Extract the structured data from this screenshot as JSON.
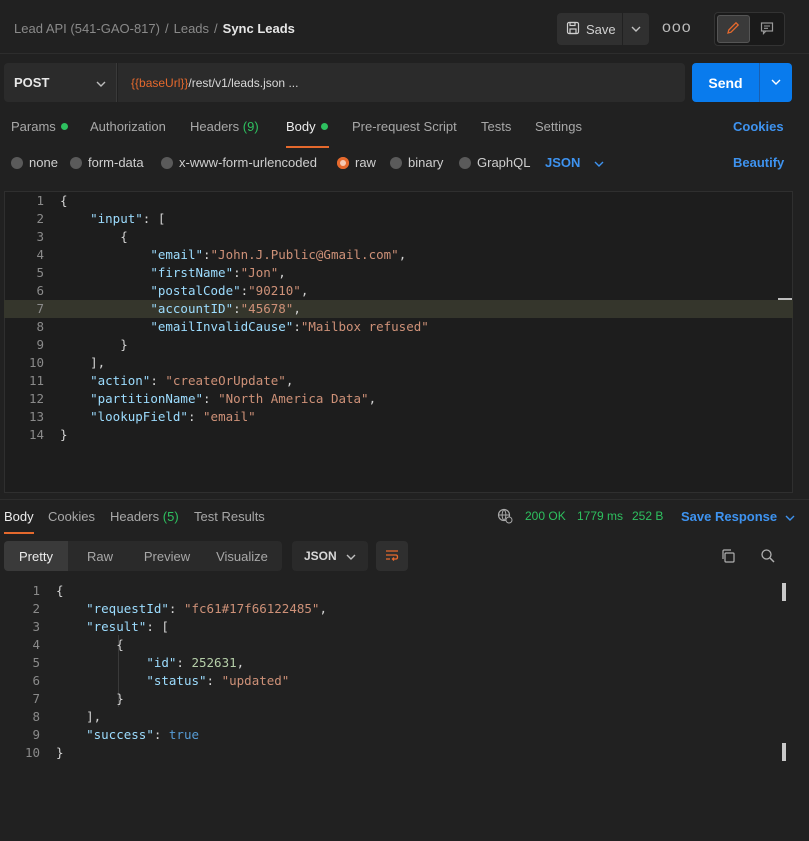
{
  "header": {
    "breadcrumb": [
      "Lead API (541-GAO-817)",
      "Leads",
      "Sync Leads"
    ],
    "separator": "/",
    "save_label": "Save",
    "more_label": "ooo"
  },
  "request": {
    "method": "POST",
    "url_variable": "{{baseUrl}}",
    "url_path": "/rest/v1/leads.json ...",
    "send_label": "Send",
    "tabs": [
      {
        "label": "Params",
        "dot": true
      },
      {
        "label": "Authorization"
      },
      {
        "label": "Headers",
        "count": "(9)"
      },
      {
        "label": "Body",
        "dot": true,
        "active": true
      },
      {
        "label": "Pre-request Script"
      },
      {
        "label": "Tests"
      },
      {
        "label": "Settings"
      }
    ],
    "cookies_label": "Cookies",
    "body_types": [
      "none",
      "form-data",
      "x-www-form-urlencoded",
      "raw",
      "binary",
      "GraphQL"
    ],
    "selected_body_type": "raw",
    "format_label": "JSON",
    "beautify_label": "Beautify",
    "body_lines": [
      "{",
      "    \"input\": [",
      "        {",
      "            \"email\":\"John.J.Public@Gmail.com\",",
      "            \"firstName\":\"Jon\",",
      "            \"postalCode\":\"90210\",",
      "            \"accountID\":\"45678\",",
      "            \"emailInvalidCause\":\"Mailbox refused\"",
      "        }",
      "    ],",
      "    \"action\": \"createOrUpdate\",",
      "    \"partitionName\": \"North America Data\",",
      "    \"lookupField\": \"email\"",
      "}"
    ],
    "highlighted_line": 7
  },
  "response": {
    "tabs": [
      {
        "label": "Body",
        "active": true
      },
      {
        "label": "Cookies"
      },
      {
        "label": "Headers",
        "count": "(5)"
      },
      {
        "label": "Test Results"
      }
    ],
    "status": "200 OK",
    "time": "1779 ms",
    "size": "252 B",
    "save_response_label": "Save Response",
    "view_modes": [
      "Pretty",
      "Raw",
      "Preview",
      "Visualize"
    ],
    "format_label": "JSON",
    "body_lines": [
      "{",
      "    \"requestId\": \"fc61#17f66122485\",",
      "    \"result\": [",
      "        {",
      "            \"id\": 252631,",
      "            \"status\": \"updated\"",
      "        }",
      "    ],",
      "    \"success\": true",
      "}"
    ]
  },
  "colors": {
    "accent_orange": "#e5692d",
    "send_blue": "#097bed",
    "link_blue": "#3e93f0",
    "status_green": "#2ec05f"
  }
}
